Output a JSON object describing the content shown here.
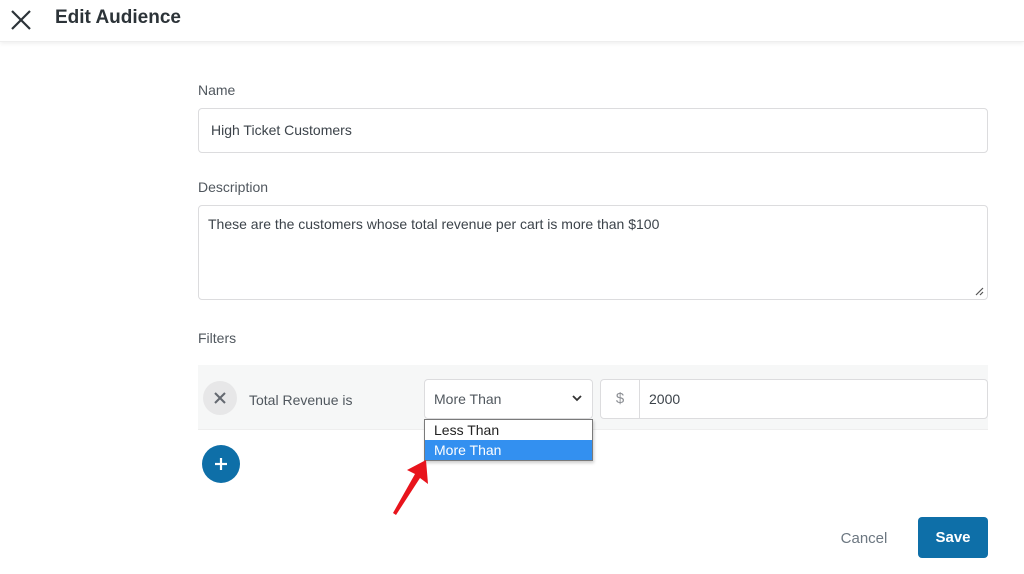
{
  "header": {
    "title": "Edit Audience",
    "close_icon": "close-icon"
  },
  "form": {
    "name": {
      "label": "Name",
      "value": "High Ticket Customers"
    },
    "description": {
      "label": "Description",
      "value": "These are the customers whose total revenue per cart is more than $100"
    },
    "filters": {
      "label": "Filters",
      "items": [
        {
          "field_label": "Total Revenue is",
          "operator_selected": "More Than",
          "operator_options": [
            "Less Than",
            "More Than"
          ],
          "currency_symbol": "$",
          "amount": "2000"
        }
      ],
      "add_icon": "plus-icon",
      "remove_icon": "close-icon"
    }
  },
  "actions": {
    "cancel_label": "Cancel",
    "save_label": "Save"
  },
  "colors": {
    "primary": "#0e6fa8",
    "highlight": "#3390f0",
    "annotation_arrow": "#e8141c"
  }
}
